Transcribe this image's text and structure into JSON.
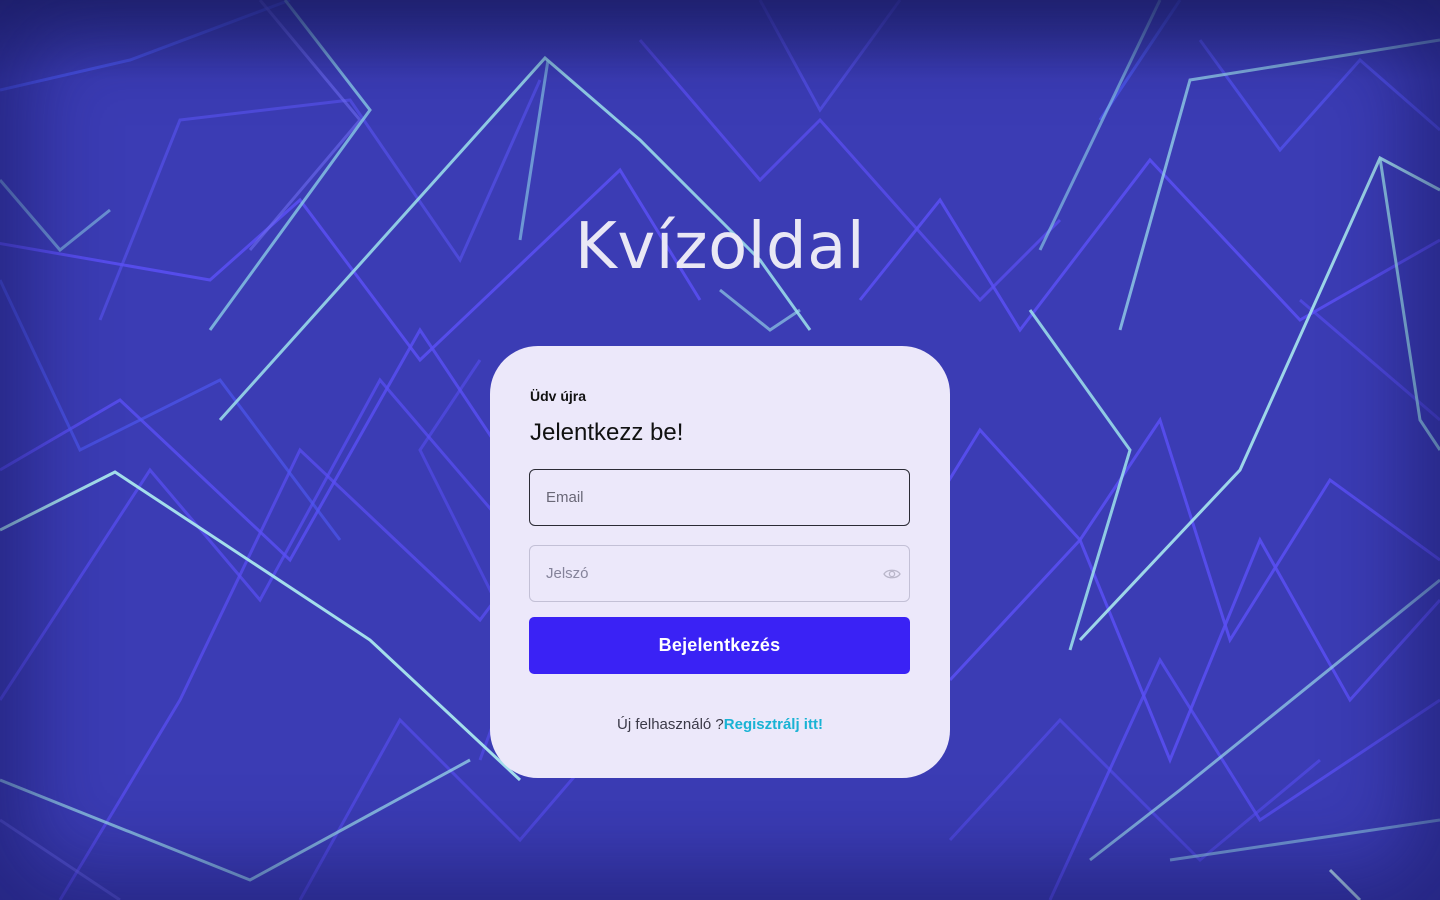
{
  "site": {
    "title": "Kvízoldal"
  },
  "login": {
    "greeting": "Üdv újra",
    "headline": "Jelentkezz be!",
    "email_placeholder": "Email",
    "password_placeholder": "Jelszó",
    "submit_label": "Bejelentkezés",
    "new_user_text": "Új felhasználó ?",
    "register_link_label": "Regisztrálj itt!"
  },
  "colors": {
    "background": "#3b3cb4",
    "card": "#ece8fa",
    "primary_button": "#3a22f5",
    "link": "#19b3d4"
  },
  "icons": {
    "password_toggle": "eye-icon"
  }
}
